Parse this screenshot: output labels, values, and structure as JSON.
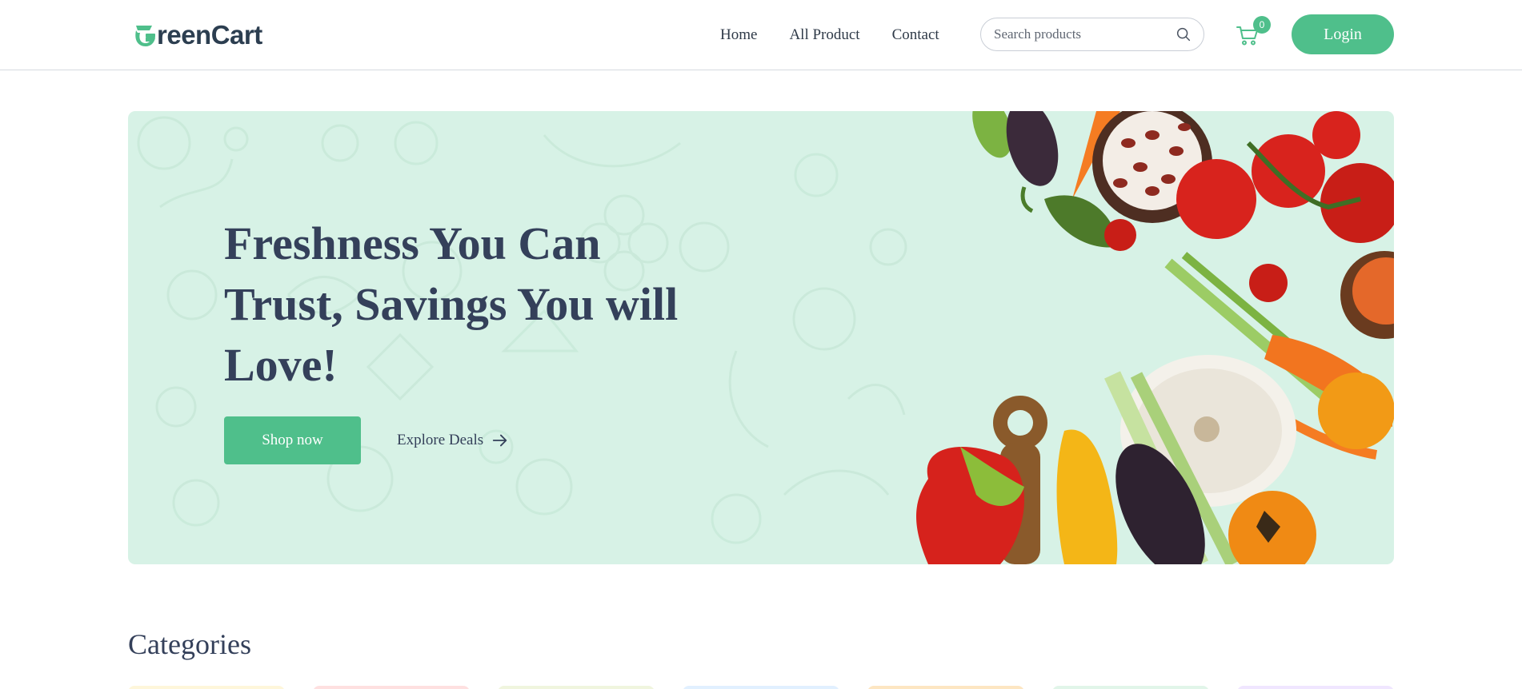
{
  "brand": {
    "name": "reenCart",
    "accent": "#4fbf8b",
    "logo_icon": "greencart-g-logo-icon"
  },
  "nav": {
    "links": [
      "Home",
      "All Product",
      "Contact"
    ]
  },
  "search": {
    "placeholder": "Search products",
    "icon": "search-icon"
  },
  "cart": {
    "count": "0",
    "icon": "shopping-cart-icon"
  },
  "login": {
    "label": "Login"
  },
  "hero": {
    "headline": "Freshness You Can Trust, Savings You will Love!",
    "primary_cta": "Shop now",
    "secondary_cta": "Explore Deals",
    "secondary_icon": "arrow-right-icon",
    "background": "#d7f2e6",
    "image": "fresh-vegetables-illustration"
  },
  "categories": {
    "title": "Categories",
    "card_colors": [
      "#fef6da",
      "#fee0e0",
      "#f0f5de",
      "#e1f0ff",
      "#fde6c2",
      "#e1f5e9",
      "#f0e6ff"
    ]
  }
}
